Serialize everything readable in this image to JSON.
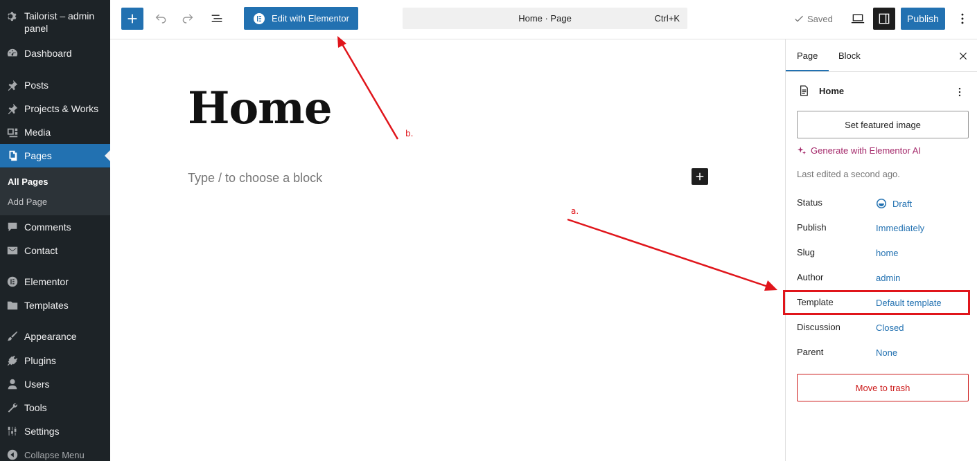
{
  "sidebar": {
    "site_title": "Tailorist – admin panel",
    "items": [
      {
        "label": "Dashboard"
      },
      {
        "label": "Posts"
      },
      {
        "label": "Projects & Works"
      },
      {
        "label": "Media"
      },
      {
        "label": "Pages"
      },
      {
        "label": "Comments"
      },
      {
        "label": "Contact"
      },
      {
        "label": "Elementor"
      },
      {
        "label": "Templates"
      },
      {
        "label": "Appearance"
      },
      {
        "label": "Plugins"
      },
      {
        "label": "Users"
      },
      {
        "label": "Tools"
      },
      {
        "label": "Settings"
      }
    ],
    "submenu": [
      {
        "label": "All Pages"
      },
      {
        "label": "Add Page"
      }
    ],
    "collapse_label": "Collapse Menu",
    "active_color": "#2271b1"
  },
  "toolbar": {
    "elementor_label": "Edit with Elementor",
    "command_label": "Home · Page",
    "command_shortcut": "Ctrl+K",
    "saved_label": "Saved",
    "publish_label": "Publish"
  },
  "canvas": {
    "title": "Home",
    "placeholder": "Type / to choose a block"
  },
  "inspector": {
    "tabs": [
      {
        "label": "Page"
      },
      {
        "label": "Block"
      }
    ],
    "doc_title": "Home",
    "featured_image_label": "Set featured image",
    "ai_label": "Generate with Elementor AI",
    "last_edited": "Last edited a second ago.",
    "properties": [
      {
        "label": "Status",
        "value": "Draft"
      },
      {
        "label": "Publish",
        "value": "Immediately"
      },
      {
        "label": "Slug",
        "value": "home"
      },
      {
        "label": "Author",
        "value": "admin"
      },
      {
        "label": "Template",
        "value": "Default template"
      },
      {
        "label": "Discussion",
        "value": "Closed"
      },
      {
        "label": "Parent",
        "value": "None"
      }
    ],
    "trash_label": "Move to trash"
  },
  "annotations": {
    "a_label": "a.",
    "b_label": "b.",
    "color": "#e0151b"
  }
}
